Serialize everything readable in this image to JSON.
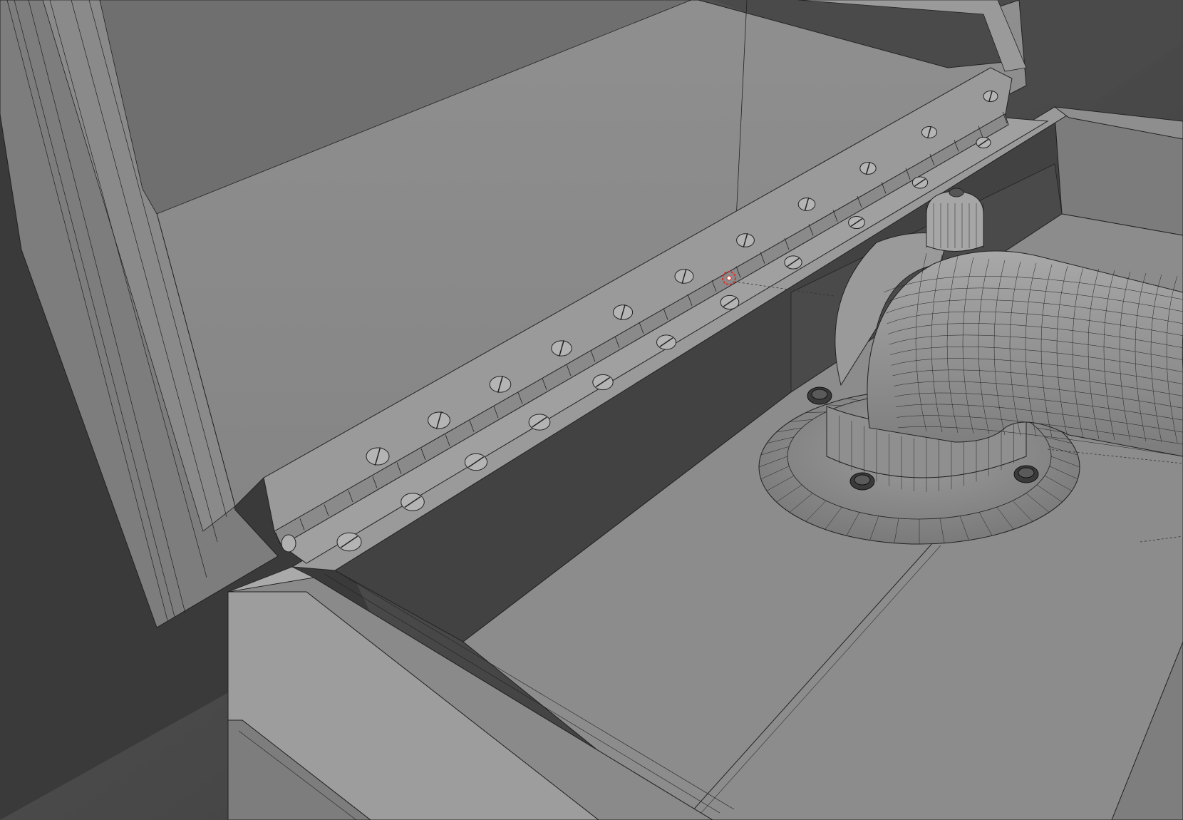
{
  "viewport": {
    "description_label": "",
    "colors": {
      "background_dark": "#3b3a3b",
      "background_light": "#565656",
      "surface": "#8a8a8a",
      "surface_light": "#9a9a9a",
      "surface_dark": "#6e6e6e",
      "wire": "#1f1f1f",
      "origin_marker": "#d8302a"
    },
    "objects": [
      {
        "name": "phonograph-lid",
        "icon": "lid"
      },
      {
        "name": "piano-hinge",
        "icon": "hinge",
        "screw_count_lid": 11,
        "screw_count_base": 11
      },
      {
        "name": "cabinet-box",
        "icon": "box"
      },
      {
        "name": "tone-arm-elbow",
        "icon": "pipe"
      },
      {
        "name": "tone-arm-flange",
        "icon": "flange",
        "screw_count": 4
      }
    ],
    "origin_marker": {
      "icon": "3d-cursor-icon"
    }
  }
}
